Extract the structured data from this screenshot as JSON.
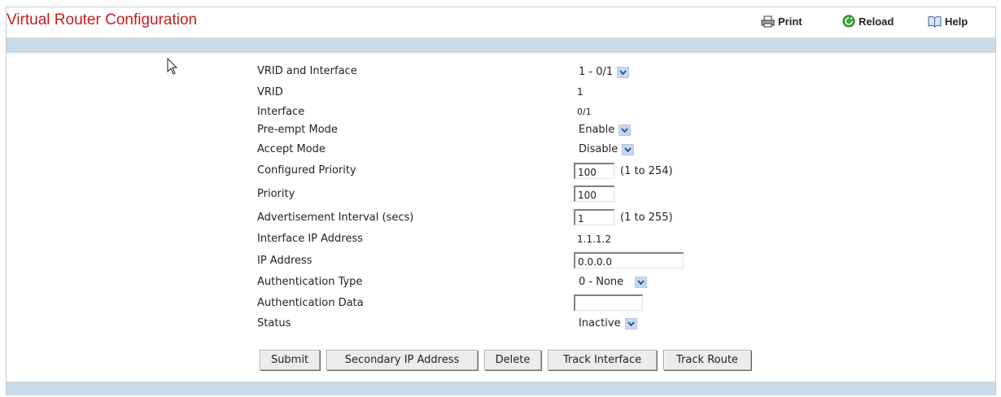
{
  "header": {
    "title": "Virtual Router Configuration",
    "print_label": "Print",
    "reload_label": "Reload",
    "help_label": "Help"
  },
  "colors": {
    "title": "#c41e1e",
    "band": "#c9dbe8",
    "dropdown_button": "#c6d8ee"
  },
  "form": {
    "vrid_interface": {
      "label": "VRID and Interface",
      "value": "1 - 0/1"
    },
    "vrid": {
      "label": "VRID",
      "value": "1"
    },
    "interface": {
      "label": "Interface",
      "value": "0/1"
    },
    "preempt": {
      "label": "Pre-empt Mode",
      "value": "Enable"
    },
    "accept": {
      "label": "Accept Mode",
      "value": "Disable"
    },
    "configured_priority": {
      "label": "Configured Priority",
      "value": "100",
      "hint": "(1 to 254)"
    },
    "priority": {
      "label": "Priority",
      "value": "100"
    },
    "adv_interval": {
      "label": "Advertisement Interval (secs)",
      "value": "1",
      "hint": "(1 to 255)"
    },
    "interface_ip": {
      "label": "Interface IP Address",
      "value": "1.1.1.2"
    },
    "ip_address": {
      "label": "IP Address",
      "value": "0.0.0.0"
    },
    "auth_type": {
      "label": "Authentication Type",
      "value": "0 - None"
    },
    "auth_data": {
      "label": "Authentication Data",
      "value": ""
    },
    "status": {
      "label": "Status",
      "value": "Inactive"
    }
  },
  "buttons": {
    "submit": "Submit",
    "secondary_ip": "Secondary IP Address",
    "delete": "Delete",
    "track_interface": "Track Interface",
    "track_route": "Track Route"
  },
  "icons": [
    "printer-icon",
    "reload-icon",
    "help-book-icon",
    "chevron-down-icon",
    "mouse-cursor-icon"
  ]
}
